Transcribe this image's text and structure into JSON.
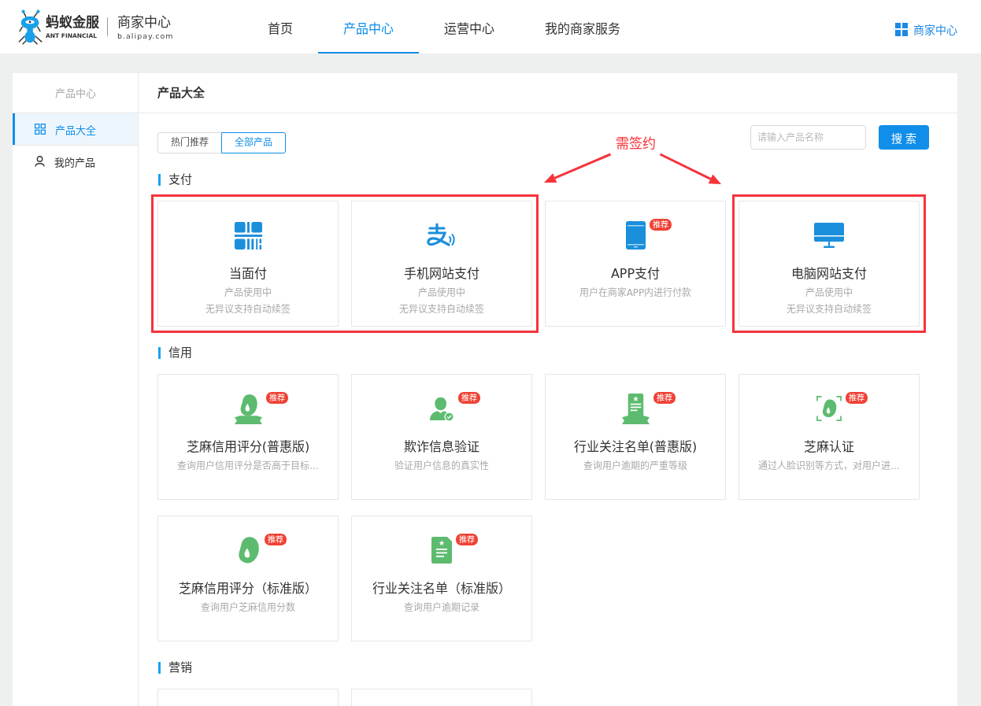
{
  "header": {
    "logo": {
      "name": "蚂蚁金服",
      "name_en": "ANT FINANCIAL",
      "product": "商家中心",
      "domain": "b.alipay.com"
    },
    "nav": [
      {
        "label": "首页",
        "selected": false
      },
      {
        "label": "产品中心",
        "selected": true
      },
      {
        "label": "运营中心",
        "selected": false
      },
      {
        "label": "我的商家服务",
        "selected": false
      }
    ],
    "merchant_link": "商家中心"
  },
  "sidebar": {
    "title": "产品中心",
    "items": [
      {
        "label": "产品大全",
        "selected": true
      },
      {
        "label": "我的产品",
        "selected": false
      }
    ]
  },
  "content": {
    "title": "产品大全",
    "tabs": [
      {
        "label": "热门推荐",
        "selected": false
      },
      {
        "label": "全部产品",
        "selected": true
      }
    ],
    "search": {
      "placeholder": "请输入产品名称"
    },
    "search_button": "搜 索",
    "annotation": {
      "label": "需签约"
    },
    "sections": [
      {
        "title": "支付",
        "cards": [
          {
            "title": "当面付",
            "lines": [
              "产品使用中",
              "无异议支持自动续签"
            ],
            "boxed": true
          },
          {
            "title": "手机网站支付",
            "lines": [
              "产品使用中",
              "无异议支持自动续签"
            ],
            "boxed": true
          },
          {
            "title": "APP支付",
            "badge": "推荐",
            "lines": [
              "用户在商家APP内进行付款"
            ],
            "boxed": false
          },
          {
            "title": "电脑网站支付",
            "lines": [
              "产品使用中",
              "无异议支持自动续签"
            ],
            "boxed": true
          }
        ]
      },
      {
        "title": "信用",
        "cards": [
          {
            "title": "芝麻信用评分(普惠版)",
            "badge": "推荐",
            "lines": [
              "查询用户信用评分是否高于目标..."
            ],
            "boxed": false
          },
          {
            "title": "欺诈信息验证",
            "badge": "推荐",
            "lines": [
              "验证用户信息的真实性"
            ],
            "boxed": false
          },
          {
            "title": "行业关注名单(普惠版)",
            "badge": "推荐",
            "lines": [
              "查询用户逾期的严重等级"
            ],
            "boxed": false
          },
          {
            "title": "芝麻认证",
            "badge": "推荐",
            "lines": [
              "通过人脸识别等方式，对用户进..."
            ],
            "boxed": false
          },
          {
            "title": "芝麻信用评分（标准版）",
            "badge": "推荐",
            "lines": [
              "查询用户芝麻信用分数"
            ],
            "boxed": false
          },
          {
            "title": "行业关注名单（标准版）",
            "badge": "推荐",
            "lines": [
              "查询用户逾期记录"
            ],
            "boxed": false
          }
        ]
      },
      {
        "title": "营销",
        "cards": [
          {
            "boxed": false
          },
          {
            "boxed": false
          }
        ]
      }
    ]
  }
}
